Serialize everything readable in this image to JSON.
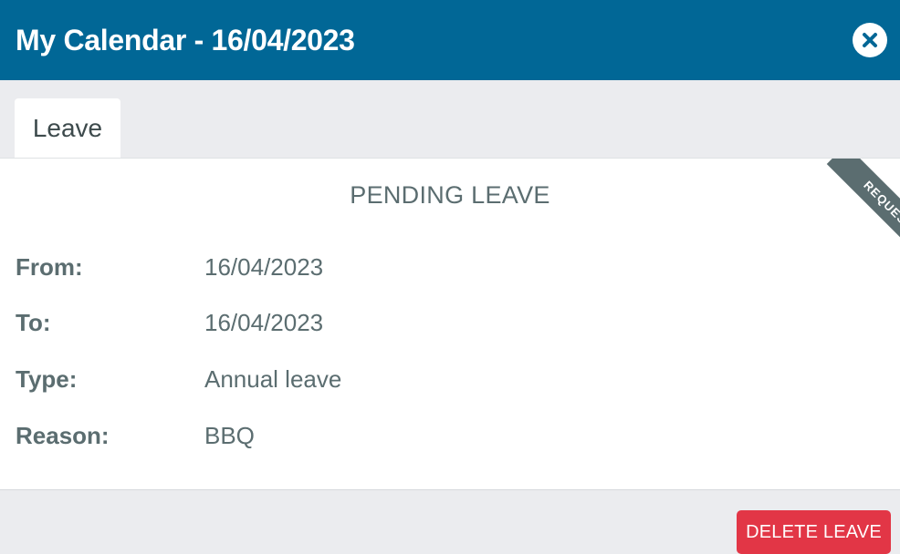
{
  "header": {
    "title": "My Calendar - 16/04/2023",
    "close_icon": "close-icon"
  },
  "tabs": [
    {
      "label": "Leave",
      "active": true
    }
  ],
  "leave": {
    "heading": "PENDING LEAVE",
    "status_ribbon": "REQUESTED",
    "fields": [
      {
        "label": "From:",
        "value": "16/04/2023"
      },
      {
        "label": "To:",
        "value": "16/04/2023"
      },
      {
        "label": "Type:",
        "value": "Annual leave"
      },
      {
        "label": "Reason:",
        "value": "BBQ"
      }
    ]
  },
  "footer": {
    "delete_label": "DELETE LEAVE"
  },
  "colors": {
    "header_bg": "#016796",
    "delete_button": "#e23646",
    "ribbon": "#5b6d70",
    "text": "#5b6d70"
  }
}
